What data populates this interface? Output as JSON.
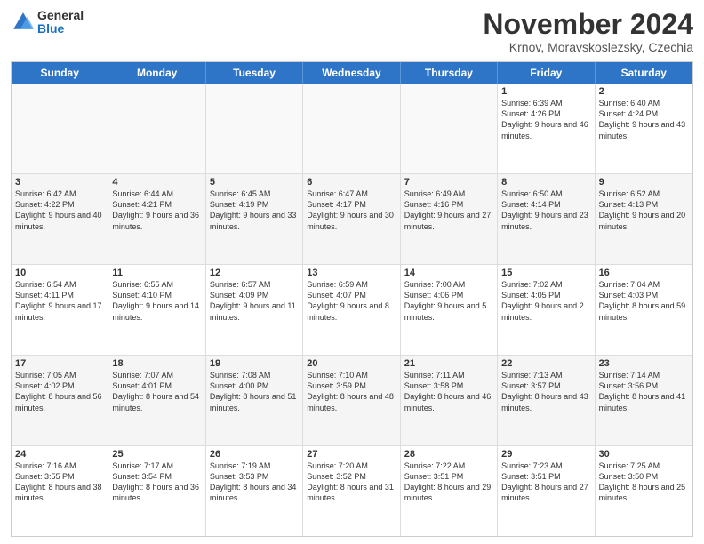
{
  "header": {
    "logo_general": "General",
    "logo_blue": "Blue",
    "title": "November 2024",
    "location": "Krnov, Moravskoslezsky, Czechia"
  },
  "calendar": {
    "days_of_week": [
      "Sunday",
      "Monday",
      "Tuesday",
      "Wednesday",
      "Thursday",
      "Friday",
      "Saturday"
    ],
    "rows": [
      [
        {
          "day": "",
          "info": "",
          "empty": true
        },
        {
          "day": "",
          "info": "",
          "empty": true
        },
        {
          "day": "",
          "info": "",
          "empty": true
        },
        {
          "day": "",
          "info": "",
          "empty": true
        },
        {
          "day": "",
          "info": "",
          "empty": true
        },
        {
          "day": "1",
          "info": "Sunrise: 6:39 AM\nSunset: 4:26 PM\nDaylight: 9 hours and 46 minutes.",
          "empty": false
        },
        {
          "day": "2",
          "info": "Sunrise: 6:40 AM\nSunset: 4:24 PM\nDaylight: 9 hours and 43 minutes.",
          "empty": false
        }
      ],
      [
        {
          "day": "3",
          "info": "Sunrise: 6:42 AM\nSunset: 4:22 PM\nDaylight: 9 hours and 40 minutes.",
          "empty": false
        },
        {
          "day": "4",
          "info": "Sunrise: 6:44 AM\nSunset: 4:21 PM\nDaylight: 9 hours and 36 minutes.",
          "empty": false
        },
        {
          "day": "5",
          "info": "Sunrise: 6:45 AM\nSunset: 4:19 PM\nDaylight: 9 hours and 33 minutes.",
          "empty": false
        },
        {
          "day": "6",
          "info": "Sunrise: 6:47 AM\nSunset: 4:17 PM\nDaylight: 9 hours and 30 minutes.",
          "empty": false
        },
        {
          "day": "7",
          "info": "Sunrise: 6:49 AM\nSunset: 4:16 PM\nDaylight: 9 hours and 27 minutes.",
          "empty": false
        },
        {
          "day": "8",
          "info": "Sunrise: 6:50 AM\nSunset: 4:14 PM\nDaylight: 9 hours and 23 minutes.",
          "empty": false
        },
        {
          "day": "9",
          "info": "Sunrise: 6:52 AM\nSunset: 4:13 PM\nDaylight: 9 hours and 20 minutes.",
          "empty": false
        }
      ],
      [
        {
          "day": "10",
          "info": "Sunrise: 6:54 AM\nSunset: 4:11 PM\nDaylight: 9 hours and 17 minutes.",
          "empty": false
        },
        {
          "day": "11",
          "info": "Sunrise: 6:55 AM\nSunset: 4:10 PM\nDaylight: 9 hours and 14 minutes.",
          "empty": false
        },
        {
          "day": "12",
          "info": "Sunrise: 6:57 AM\nSunset: 4:09 PM\nDaylight: 9 hours and 11 minutes.",
          "empty": false
        },
        {
          "day": "13",
          "info": "Sunrise: 6:59 AM\nSunset: 4:07 PM\nDaylight: 9 hours and 8 minutes.",
          "empty": false
        },
        {
          "day": "14",
          "info": "Sunrise: 7:00 AM\nSunset: 4:06 PM\nDaylight: 9 hours and 5 minutes.",
          "empty": false
        },
        {
          "day": "15",
          "info": "Sunrise: 7:02 AM\nSunset: 4:05 PM\nDaylight: 9 hours and 2 minutes.",
          "empty": false
        },
        {
          "day": "16",
          "info": "Sunrise: 7:04 AM\nSunset: 4:03 PM\nDaylight: 8 hours and 59 minutes.",
          "empty": false
        }
      ],
      [
        {
          "day": "17",
          "info": "Sunrise: 7:05 AM\nSunset: 4:02 PM\nDaylight: 8 hours and 56 minutes.",
          "empty": false
        },
        {
          "day": "18",
          "info": "Sunrise: 7:07 AM\nSunset: 4:01 PM\nDaylight: 8 hours and 54 minutes.",
          "empty": false
        },
        {
          "day": "19",
          "info": "Sunrise: 7:08 AM\nSunset: 4:00 PM\nDaylight: 8 hours and 51 minutes.",
          "empty": false
        },
        {
          "day": "20",
          "info": "Sunrise: 7:10 AM\nSunset: 3:59 PM\nDaylight: 8 hours and 48 minutes.",
          "empty": false
        },
        {
          "day": "21",
          "info": "Sunrise: 7:11 AM\nSunset: 3:58 PM\nDaylight: 8 hours and 46 minutes.",
          "empty": false
        },
        {
          "day": "22",
          "info": "Sunrise: 7:13 AM\nSunset: 3:57 PM\nDaylight: 8 hours and 43 minutes.",
          "empty": false
        },
        {
          "day": "23",
          "info": "Sunrise: 7:14 AM\nSunset: 3:56 PM\nDaylight: 8 hours and 41 minutes.",
          "empty": false
        }
      ],
      [
        {
          "day": "24",
          "info": "Sunrise: 7:16 AM\nSunset: 3:55 PM\nDaylight: 8 hours and 38 minutes.",
          "empty": false
        },
        {
          "day": "25",
          "info": "Sunrise: 7:17 AM\nSunset: 3:54 PM\nDaylight: 8 hours and 36 minutes.",
          "empty": false
        },
        {
          "day": "26",
          "info": "Sunrise: 7:19 AM\nSunset: 3:53 PM\nDaylight: 8 hours and 34 minutes.",
          "empty": false
        },
        {
          "day": "27",
          "info": "Sunrise: 7:20 AM\nSunset: 3:52 PM\nDaylight: 8 hours and 31 minutes.",
          "empty": false
        },
        {
          "day": "28",
          "info": "Sunrise: 7:22 AM\nSunset: 3:51 PM\nDaylight: 8 hours and 29 minutes.",
          "empty": false
        },
        {
          "day": "29",
          "info": "Sunrise: 7:23 AM\nSunset: 3:51 PM\nDaylight: 8 hours and 27 minutes.",
          "empty": false
        },
        {
          "day": "30",
          "info": "Sunrise: 7:25 AM\nSunset: 3:50 PM\nDaylight: 8 hours and 25 minutes.",
          "empty": false
        }
      ]
    ]
  }
}
